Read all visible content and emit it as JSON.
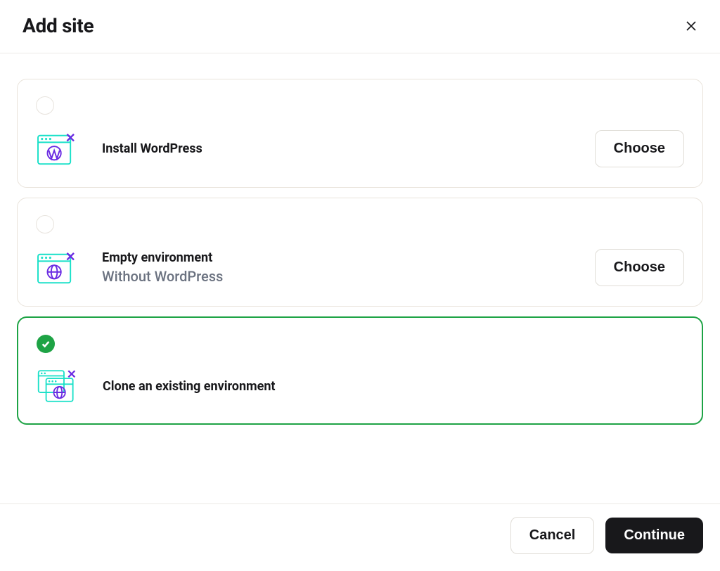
{
  "header": {
    "title": "Add site"
  },
  "options": [
    {
      "title": "Install WordPress",
      "subtitle": "",
      "choose_label": "Choose"
    },
    {
      "title": "Empty environment",
      "subtitle": "Without WordPress",
      "choose_label": "Choose"
    },
    {
      "title": "Clone an existing environment",
      "subtitle": ""
    }
  ],
  "footer": {
    "cancel_label": "Cancel",
    "continue_label": "Continue"
  }
}
